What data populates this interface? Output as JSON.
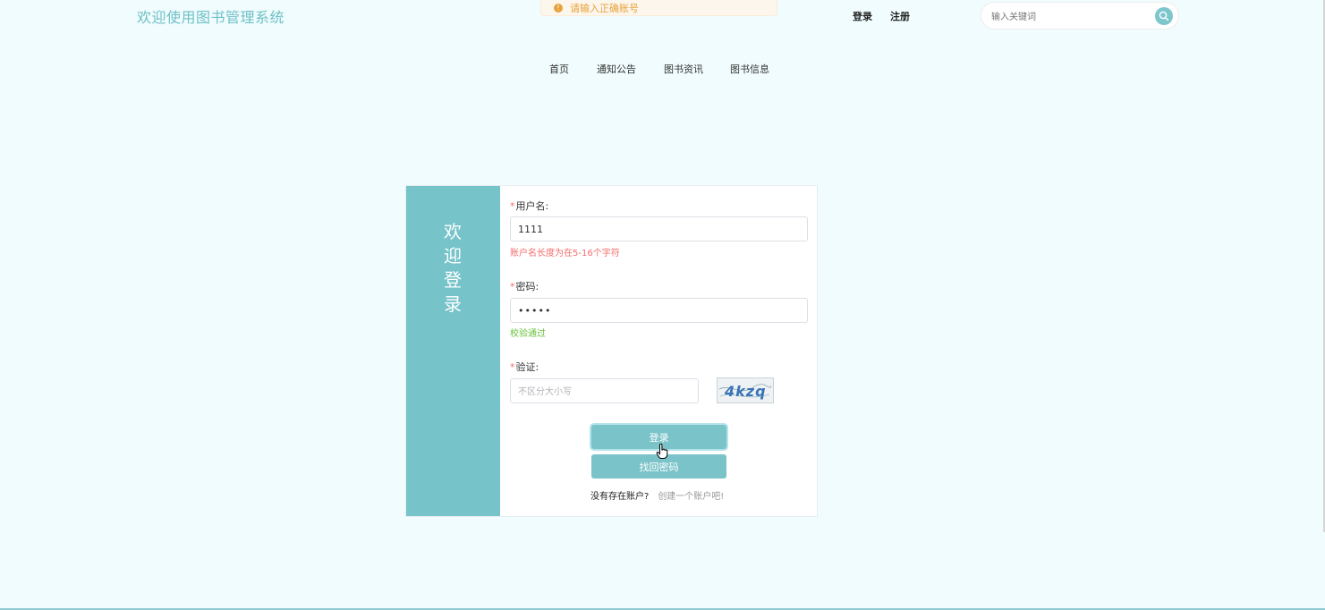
{
  "header": {
    "site_title": "欢迎使用图书管理系统",
    "toast_message": "请输入正确账号",
    "login_link": "登录",
    "register_link": "注册",
    "search_placeholder": "输入关键词"
  },
  "nav": {
    "items": [
      {
        "label": "首页"
      },
      {
        "label": "通知公告"
      },
      {
        "label": "图书资讯"
      },
      {
        "label": "图书信息"
      }
    ]
  },
  "login": {
    "welcome": "欢迎登录",
    "required_mark": "*",
    "username_label": "用户名:",
    "username_value": "1111",
    "username_error": "账户名长度为在5-16个字符",
    "password_label": "密码:",
    "password_value": "•••••",
    "password_ok": "校验通过",
    "captcha_label": "验证:",
    "captcha_placeholder": "不区分大小写",
    "captcha_text": "4kzq",
    "login_button": "登录",
    "forgot_button": "找回密码",
    "no_account": "没有存在账户?",
    "create_account": "创建一个账户吧!"
  },
  "colors": {
    "accent": "#76c3c9",
    "background": "#f0fcfd",
    "error": "#f56c6c",
    "success": "#67c23a",
    "toast": "#e6a23c"
  }
}
